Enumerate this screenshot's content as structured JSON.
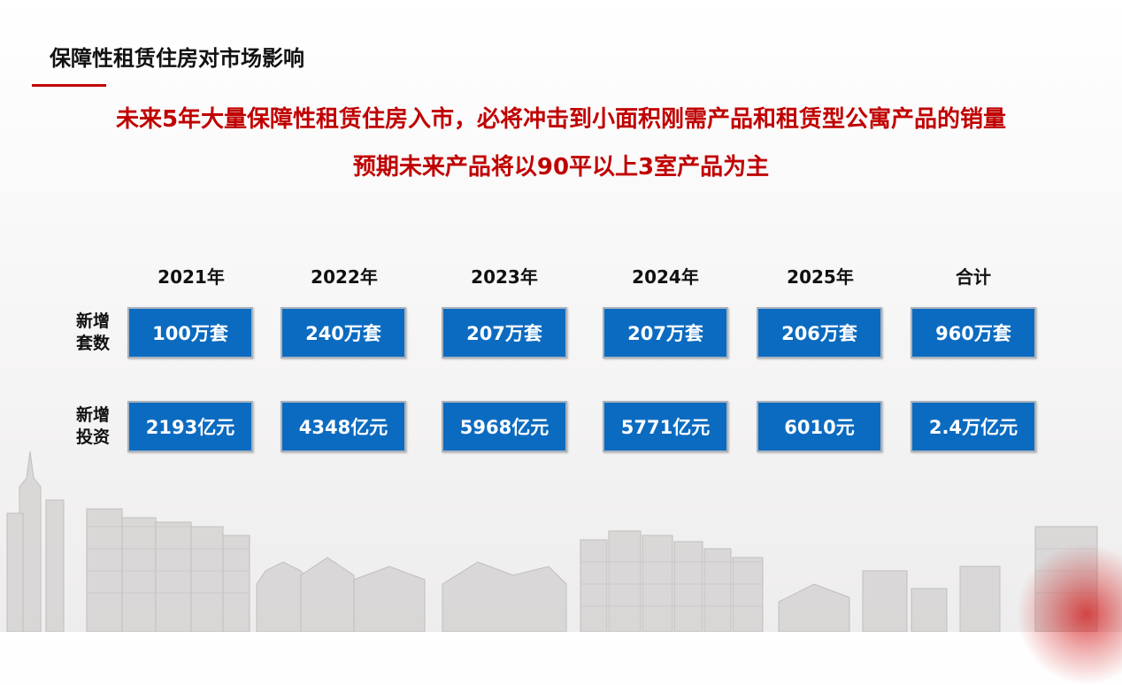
{
  "title": "保障性租赁住房对市场影响",
  "headline": {
    "line1": "未来5年大量保障性租赁住房入市，必将冲击到小面积刚需产品和租赁型公寓产品的销量",
    "line2": "预期未来产品将以90平以上3室产品为主"
  },
  "table": {
    "columns": [
      "2021年",
      "2022年",
      "2023年",
      "2024年",
      "2025年",
      "合计"
    ],
    "rows": [
      {
        "label": [
          "新增",
          "套数"
        ],
        "values": [
          "100万套",
          "240万套",
          "207万套",
          "207万套",
          "206万套",
          "960万套"
        ]
      },
      {
        "label": [
          "新增",
          "投资"
        ],
        "values": [
          "2193亿元",
          "4348亿元",
          "5968亿元",
          "5771亿元",
          "6010元",
          "2.4万亿元"
        ]
      }
    ]
  },
  "colors": {
    "accent_red": "#c00000",
    "cell_blue": "#0b6bc0",
    "cell_border": "#a8b1bd"
  }
}
